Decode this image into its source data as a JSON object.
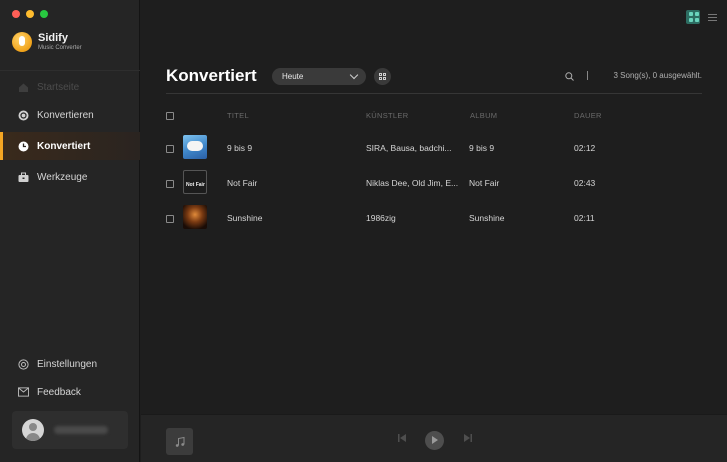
{
  "app": {
    "name": "Sidify",
    "subtitle": "Music Converter"
  },
  "sidebar": {
    "items": [
      {
        "label": "Startseite",
        "icon": "home-icon",
        "state": "disabled"
      },
      {
        "label": "Konvertieren",
        "icon": "convert-icon",
        "state": "normal"
      },
      {
        "label": "Konvertiert",
        "icon": "clock-icon",
        "state": "active"
      },
      {
        "label": "Werkzeuge",
        "icon": "toolbox-icon",
        "state": "normal"
      }
    ],
    "bottom_items": [
      {
        "label": "Einstellungen",
        "icon": "gear-icon"
      },
      {
        "label": "Feedback",
        "icon": "mail-icon"
      }
    ],
    "user": {
      "avatar": "user-icon"
    }
  },
  "header": {
    "title": "Konvertiert",
    "filter": {
      "selected": "Heute"
    },
    "count_text": "3 Song(s), 0 ausgewählt."
  },
  "table": {
    "columns": [
      "TITEL",
      "KÜNSTLER",
      "ALBUM",
      "DAUER"
    ],
    "rows": [
      {
        "title": "9 bis 9",
        "artist": "SIRA, Bausa, badchi...",
        "album": "9 bis 9",
        "duration": "02:12"
      },
      {
        "title": "Not Fair",
        "artist": "Niklas Dee, Old Jim, E...",
        "album": "Not Fair",
        "duration": "02:43"
      },
      {
        "title": "Sunshine",
        "artist": "1986zig",
        "album": "Sunshine",
        "duration": "02:11"
      }
    ]
  },
  "colors": {
    "accent": "#f5a623",
    "background": "#1e1e1e",
    "sidebar": "#252525",
    "grid_toggle": "#2d6d62"
  }
}
